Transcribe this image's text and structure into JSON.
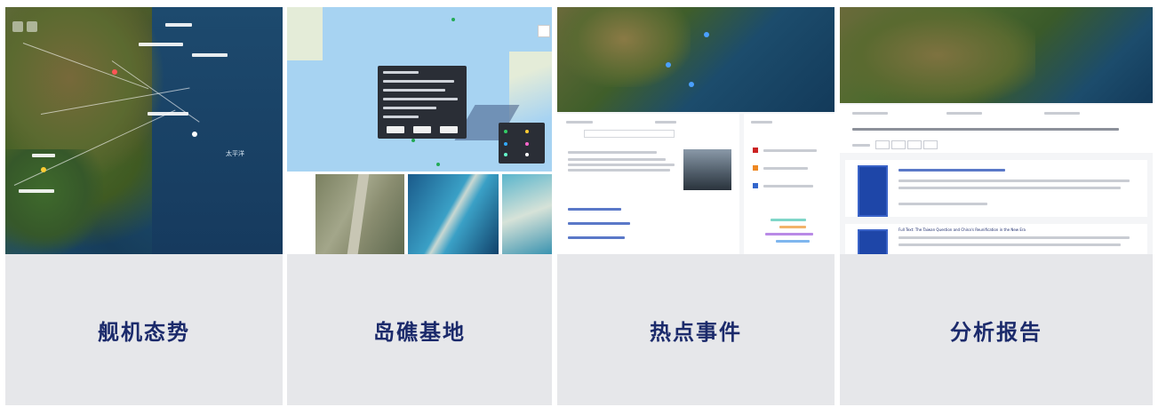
{
  "cards": [
    {
      "title": "舰机态势",
      "map_label": "太平洋"
    },
    {
      "title": "岛礁基地"
    },
    {
      "title": "热点事件"
    },
    {
      "title": "分析报告",
      "report_heading": "Full Text: The Taiwan Question and China's Reunification in the New Era"
    }
  ],
  "colors": {
    "caption": "#1b2a6b",
    "card_bg": "#e6e7ea",
    "ocean": "#a7d3f2",
    "popup": "#2a2e36",
    "report_blue": "#1e46a8"
  }
}
